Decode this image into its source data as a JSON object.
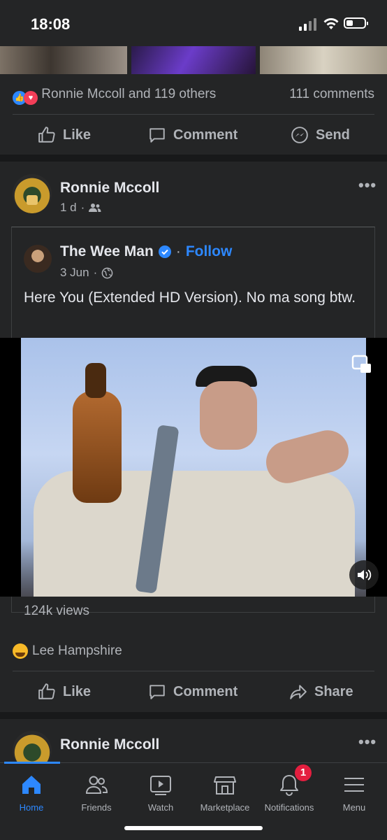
{
  "status_bar": {
    "time": "18:08"
  },
  "prev_post": {
    "reactions_text": "Ronnie Mccoll and 119 others",
    "comments_text": "111 comments",
    "actions": {
      "like": "Like",
      "comment": "Comment",
      "send": "Send"
    }
  },
  "post": {
    "author": "Ronnie Mccoll",
    "time": "1 d",
    "more": "•••",
    "shared": {
      "author": "The Wee Man",
      "follow_sep": "·",
      "follow": "Follow",
      "date": "3 Jun",
      "text": "Here You (Extended HD Version). No ma song btw.",
      "views": "124k views"
    },
    "reactor": "Lee Hampshire",
    "actions": {
      "like": "Like",
      "comment": "Comment",
      "share": "Share"
    }
  },
  "next_post": {
    "author": "Ronnie Mccoll",
    "more": "•••"
  },
  "tabs": [
    {
      "label": "Home",
      "icon": "home-icon",
      "active": true
    },
    {
      "label": "Friends",
      "icon": "friends-icon"
    },
    {
      "label": "Watch",
      "icon": "watch-icon"
    },
    {
      "label": "Marketplace",
      "icon": "marketplace-icon"
    },
    {
      "label": "Notifications",
      "icon": "bell-icon",
      "badge": "1"
    },
    {
      "label": "Menu",
      "icon": "menu-icon"
    }
  ],
  "colors": {
    "accent": "#2d88ff",
    "background": "#18191a",
    "card": "#242526",
    "badge": "#e41e3f"
  }
}
